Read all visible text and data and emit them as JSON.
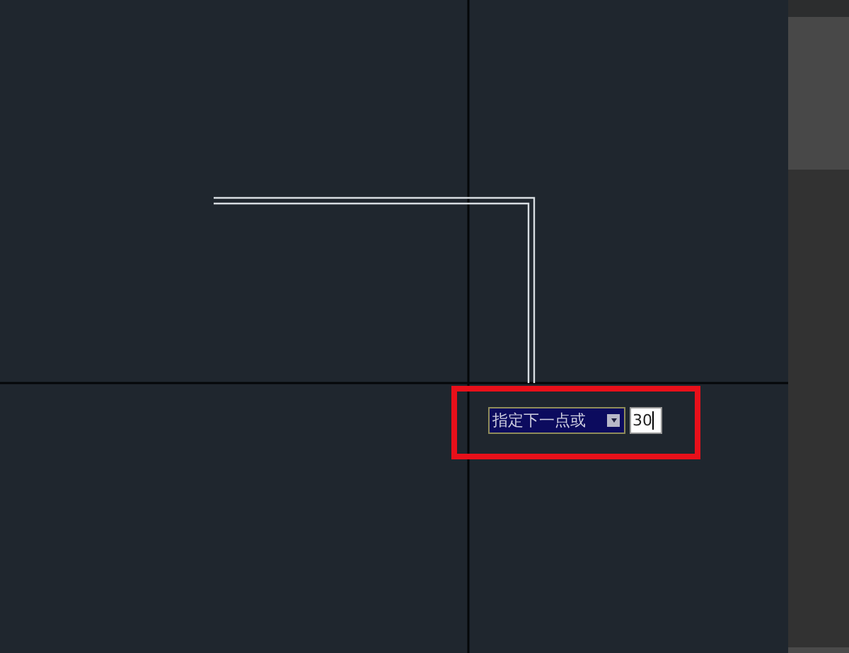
{
  "prompt": {
    "label": "指定下一点或"
  },
  "input": {
    "value": "30"
  }
}
